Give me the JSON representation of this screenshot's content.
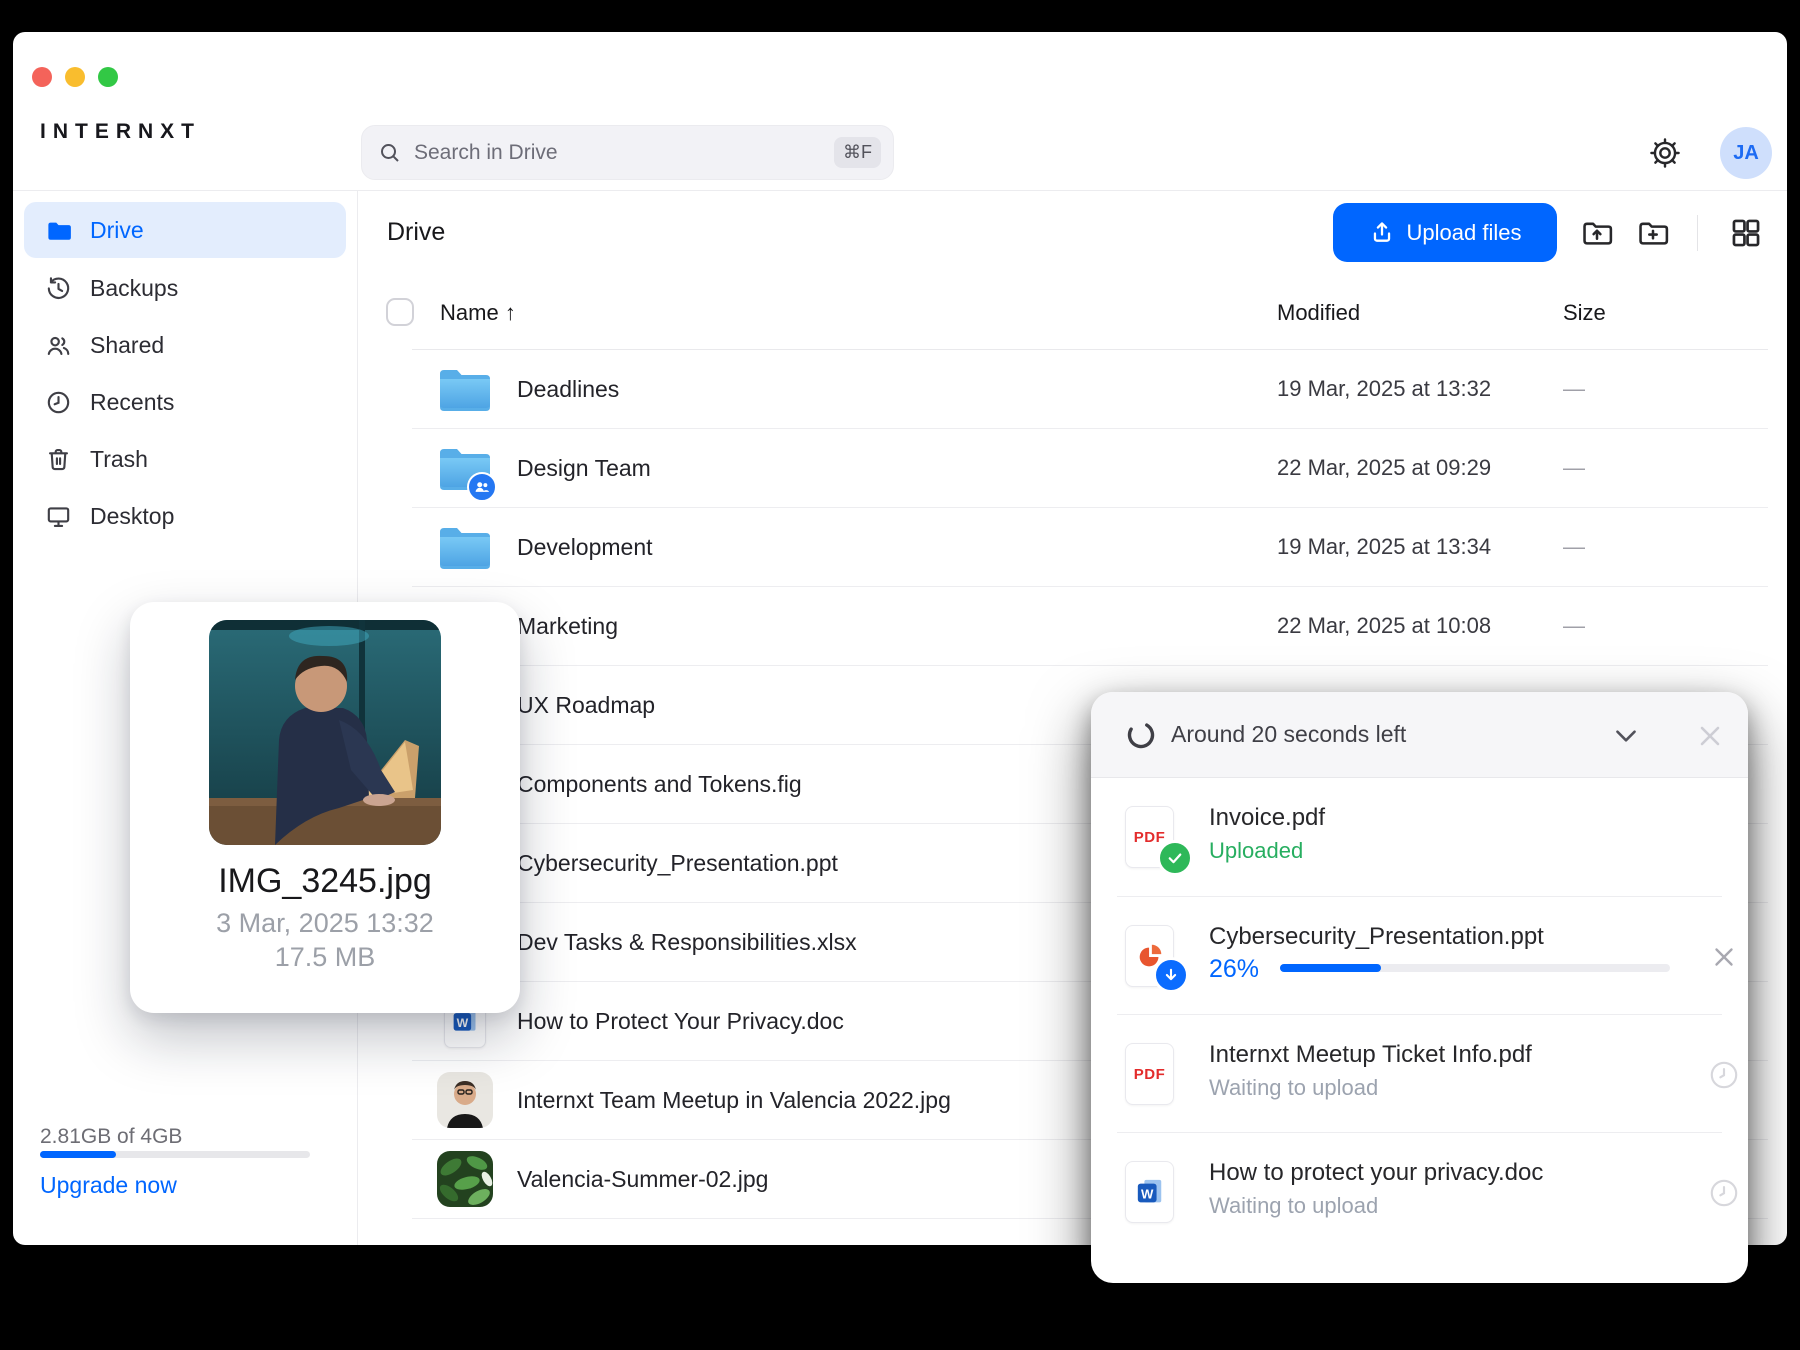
{
  "colors": {
    "accent": "#0066ff",
    "success_green": "#27ae60",
    "selected_item_bg": "#e3edfd",
    "traffic_red": "#f4635a",
    "traffic_yellow": "#f9bd2e",
    "traffic_green": "#32c845"
  },
  "header": {
    "logo": "INTERNXT",
    "search": {
      "placeholder": "Search in Drive",
      "shortcut": "⌘F"
    },
    "avatar_initials": "JA"
  },
  "sidebar": {
    "items": [
      {
        "label": "Drive",
        "active": true
      },
      {
        "label": "Backups",
        "active": false
      },
      {
        "label": "Shared",
        "active": false
      },
      {
        "label": "Recents",
        "active": false
      },
      {
        "label": "Trash",
        "active": false
      },
      {
        "label": "Desktop",
        "active": false
      }
    ],
    "storage": {
      "usage_label": "2.81GB of 4GB",
      "percent": 28,
      "upgrade_label": "Upgrade now"
    }
  },
  "toolbar": {
    "title": "Drive",
    "upload_button_label": "Upload files"
  },
  "table": {
    "columns": {
      "name": "Name",
      "modified": "Modified",
      "size": "Size"
    },
    "sort_indicator": "↑",
    "rows": [
      {
        "name": "Deadlines",
        "modified": "19 Mar, 2025 at 13:32",
        "size": "—"
      },
      {
        "name": "Design Team",
        "modified": "22 Mar, 2025 at 09:29",
        "size": "—"
      },
      {
        "name": "Development",
        "modified": "19 Mar, 2025 at 13:34",
        "size": "—"
      },
      {
        "name": "Marketing",
        "modified": "22 Mar, 2025 at 10:08",
        "size": "—"
      },
      {
        "name": "UX Roadmap",
        "modified": "",
        "size": ""
      },
      {
        "name": "Components and Tokens.fig",
        "modified": "",
        "size": ""
      },
      {
        "name": "Cybersecurity_Presentation.ppt",
        "modified": "",
        "size": ""
      },
      {
        "name": "Dev Tasks & Responsibilities.xlsx",
        "modified": "",
        "size": ""
      },
      {
        "name": "How to Protect Your Privacy.doc",
        "modified": "",
        "size": ""
      },
      {
        "name": "Internxt Team Meetup in Valencia 2022.jpg",
        "modified": "",
        "size": ""
      },
      {
        "name": "Valencia-Summer-02.jpg",
        "modified": "",
        "size": ""
      }
    ]
  },
  "preview_card": {
    "filename": "IMG_3245.jpg",
    "date": "3 Mar, 2025 13:32",
    "size": "17.5 MB"
  },
  "upload_panel": {
    "header_text": "Around 20 seconds left",
    "items": [
      {
        "name": "Invoice.pdf",
        "status": "Uploaded",
        "file_type": "pdf"
      },
      {
        "name": "Cybersecurity_Presentation.ppt",
        "status": "26%",
        "progress_percent": 26,
        "file_type": "ppt"
      },
      {
        "name": "Internxt Meetup Ticket Info.pdf",
        "status": "Waiting to upload",
        "file_type": "pdf"
      },
      {
        "name": "How to protect your privacy.doc",
        "status": "Waiting to upload",
        "file_type": "doc"
      }
    ],
    "pdf_icon_label": "PDF"
  }
}
